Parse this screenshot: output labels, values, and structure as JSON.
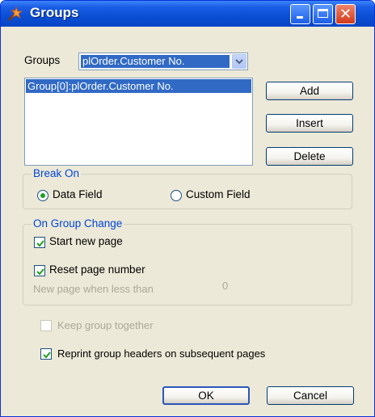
{
  "window": {
    "title": "Groups"
  },
  "groups_label": "Groups",
  "groups_combo": {
    "value": "plOrder.Customer No."
  },
  "group_list": {
    "items": [
      "Group[0]:plOrder.Customer No."
    ]
  },
  "buttons": {
    "add": "Add",
    "insert": "Insert",
    "delete": "Delete",
    "ok": "OK",
    "cancel": "Cancel"
  },
  "break_on": {
    "legend": "Break On",
    "data_field": {
      "label": "Data Field",
      "selected": true
    },
    "custom_field": {
      "label": "Custom Field",
      "selected": false
    }
  },
  "on_group_change": {
    "legend": "On Group Change",
    "start_new_page": {
      "label": "Start new page",
      "checked": true
    },
    "reset_page_number": {
      "label": "Reset page number",
      "checked": true
    },
    "new_page_when_less_than": {
      "label": "New page when less than",
      "value": "0"
    }
  },
  "keep_group_together": {
    "label": "Keep group together",
    "checked": false,
    "enabled": false
  },
  "reprint_headers": {
    "label": "Reprint group headers on subsequent pages",
    "checked": true
  },
  "colors": {
    "title_bar": "#0a4ed3",
    "selection": "#316ac5",
    "legend_text": "#0046d5",
    "dialog_bg": "#ece9d8"
  }
}
